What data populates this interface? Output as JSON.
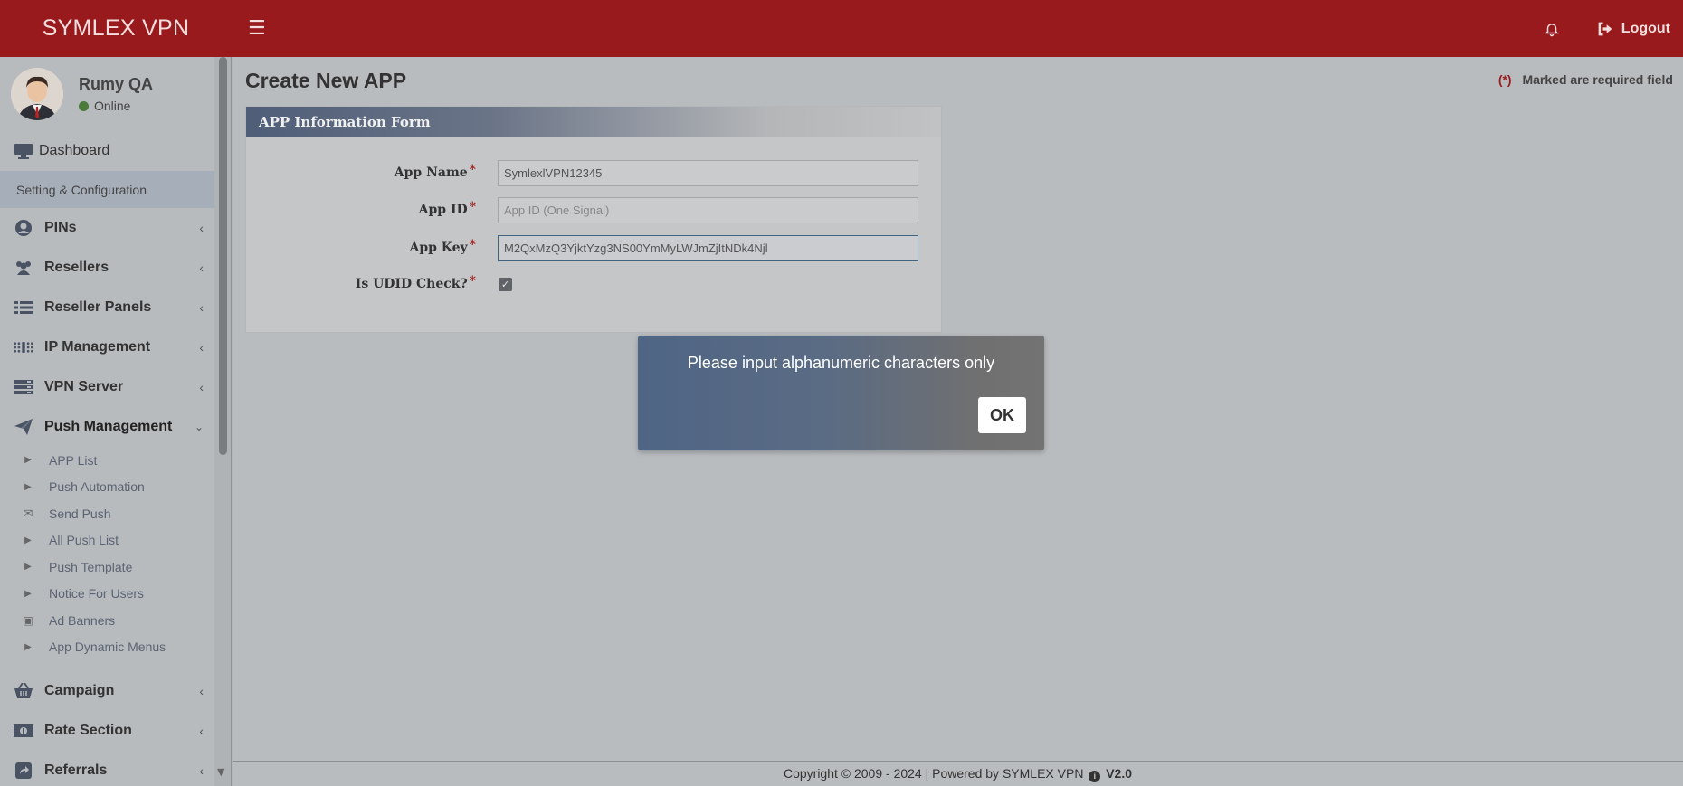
{
  "header": {
    "brand": "SYMLEX VPN",
    "logout_label": "Logout"
  },
  "user": {
    "name": "Rumy QA",
    "status": "Online"
  },
  "sidebar": {
    "dashboard": "Dashboard",
    "section_label": "Setting & Configuration",
    "items": [
      {
        "label": "PINs",
        "icon": "user-circle-icon"
      },
      {
        "label": "Resellers",
        "icon": "users-icon"
      },
      {
        "label": "Reseller Panels",
        "icon": "list-icon"
      },
      {
        "label": "IP Management",
        "icon": "ip-grid-icon"
      },
      {
        "label": "VPN Server",
        "icon": "server-icon"
      },
      {
        "label": "Push Management",
        "icon": "paper-plane-icon"
      }
    ],
    "push_submenu": [
      {
        "label": "APP List",
        "icon": "caret-right-icon"
      },
      {
        "label": "Push Automation",
        "icon": "caret-right-icon"
      },
      {
        "label": "Send Push",
        "icon": "envelope-icon"
      },
      {
        "label": "All Push List",
        "icon": "caret-right-icon"
      },
      {
        "label": "Push Template",
        "icon": "caret-right-icon"
      },
      {
        "label": "Notice For Users",
        "icon": "caret-right-icon"
      },
      {
        "label": "Ad Banners",
        "icon": "image-icon"
      },
      {
        "label": "App Dynamic Menus",
        "icon": "caret-right-icon"
      }
    ],
    "bottom_items": [
      {
        "label": "Campaign",
        "icon": "basket-icon"
      },
      {
        "label": "Rate Section",
        "icon": "money-icon"
      },
      {
        "label": "Referrals",
        "icon": "share-icon"
      }
    ]
  },
  "main": {
    "page_title": "Create New APP",
    "required_star": "(*)",
    "required_note": "Marked are required field",
    "form_title": "APP Information Form",
    "fields": {
      "app_name_label": "App Name",
      "app_name_value": "SymlexlVPN12345",
      "app_id_label": "App ID",
      "app_id_placeholder": "App ID (One Signal)",
      "app_key_label": "App Key",
      "app_key_value": "M2QxMzQ3YjktYzg3NS00YmMyLWJmZjItNDk4Njl",
      "udid_label": "Is UDID Check?",
      "udid_checked": true
    },
    "required_mark": "*"
  },
  "dialog": {
    "message": "Please input alphanumeric characters only",
    "ok_label": "OK"
  },
  "footer": {
    "text": "Copyright © 2009 - 2024 | Powered by SYMLEX VPN",
    "version": "V2.0"
  }
}
